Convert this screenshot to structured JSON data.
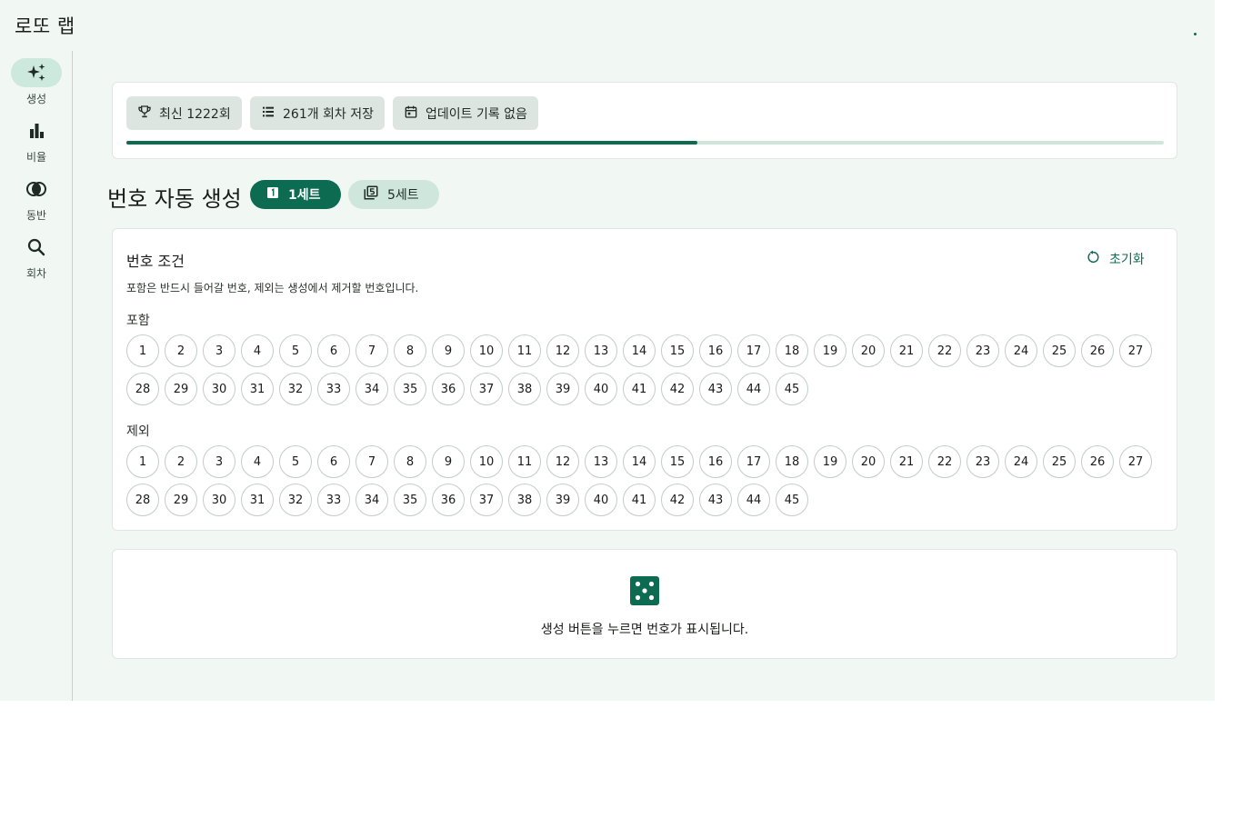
{
  "app": {
    "title": "로또 랩"
  },
  "rail": {
    "items": [
      {
        "label": "생성",
        "icon": "sparkles-icon",
        "active": true
      },
      {
        "label": "비율",
        "icon": "bar-chart-icon",
        "active": false
      },
      {
        "label": "동반",
        "icon": "overlap-circles-icon",
        "active": false
      },
      {
        "label": "회차",
        "icon": "search-icon",
        "active": false
      }
    ]
  },
  "status": {
    "chips": [
      {
        "label": "최신 1222회",
        "icon": "trophy-icon"
      },
      {
        "label": "261개 회차 저장",
        "icon": "list-icon"
      },
      {
        "label": "업데이트 기록 없음",
        "icon": "calendar-icon"
      }
    ],
    "progress_fraction": 0.55
  },
  "generator": {
    "title": "번호 자동 생성",
    "set_one_label": "1세트",
    "set_five_label": "5세트"
  },
  "conditions": {
    "title": "번호 조건",
    "reset_label": "초기화",
    "description": "포함은 반드시 들어갈 번호, 제외는 생성에서 제거할 번호입니다.",
    "include_label": "포함",
    "exclude_label": "제외",
    "numbers": [
      1,
      2,
      3,
      4,
      5,
      6,
      7,
      8,
      9,
      10,
      11,
      12,
      13,
      14,
      15,
      16,
      17,
      18,
      19,
      20,
      21,
      22,
      23,
      24,
      25,
      26,
      27,
      28,
      29,
      30,
      31,
      32,
      33,
      34,
      35,
      36,
      37,
      38,
      39,
      40,
      41,
      42,
      43,
      44,
      45
    ]
  },
  "result": {
    "icon": "dice-icon",
    "message": "생성 버튼을 누르면 번호가 표시됩니다."
  },
  "colors": {
    "accent": "#0d6b52",
    "accent_container": "#cfe6dd",
    "surface": "#f1f7f3"
  }
}
